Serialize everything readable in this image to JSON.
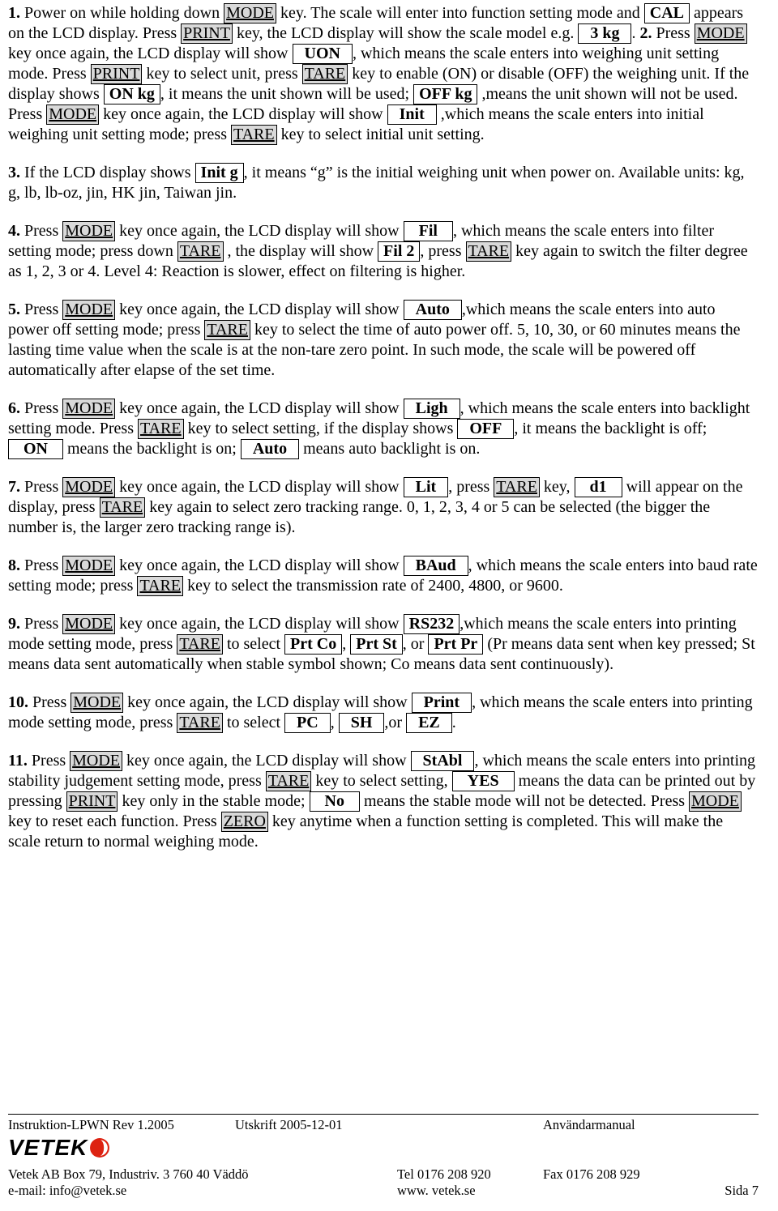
{
  "p1": {
    "n": "1.",
    "t1": " Power on while holding down ",
    "k1": "MODE",
    "t2": " key. The scale will enter into function setting mode and ",
    "l1": "CAL",
    "t3": "appears on the LCD display. Press ",
    "k2": "PRINT",
    "t4": " key, the LCD display will show the scale model e.g. ",
    "l2": "3 kg",
    "t5": ". "
  },
  "p2": {
    "n": "2.",
    "t1": " Press ",
    "k1": "MODE",
    "t2": " key once again, the LCD display will show ",
    "l1": "UON",
    "t3": ", which means the scale enters into weighing unit setting mode. Press ",
    "k2": "PRINT",
    "t4": " key to select unit, press ",
    "k3": "TARE",
    "t5": " key to enable (ON) or disable (OFF) the weighing unit. If the display shows ",
    "l2": "ON kg",
    "t6": ", it means the unit shown will be used; ",
    "l3": "OFF kg",
    "t7": " ,means the unit shown will not be used. Press ",
    "k4": "MODE",
    "t8": " key once again, the LCD display will show ",
    "l4": "Init",
    "t9": " ,which means the scale enters into initial weighing unit setting mode; press ",
    "k5": "TARE",
    "t10": " key to select initial unit setting."
  },
  "p3": {
    "n": "3.",
    "t1": " If the LCD display shows ",
    "l1": "Init  g",
    "t2": ", it means “g” is the initial weighing unit when power on. Available units: kg, g, lb, lb-oz, jin, HK jin, Taiwan jin."
  },
  "p4": {
    "n": "4.",
    "t1": " Press ",
    "k1": "MODE",
    "t2": " key once again, the LCD display will show ",
    "l1": "Fil",
    "t3": ", which means the scale enters into filter setting mode; press down ",
    "k2": "TARE",
    "t4": " , the display will show ",
    "l2": "Fil  2",
    "t5": ", press ",
    "k3": "TARE",
    "t6": " key again to switch the filter degree as 1, 2, 3 or 4. Level 4: Reaction is slower, effect on filtering is higher."
  },
  "p5": {
    "n": "5.",
    "t1": " Press ",
    "k1": "MODE",
    "t2": " key once again, the LCD display will show ",
    "l1": "Auto",
    "t3": ",which means the scale enters into auto power off setting mode; press ",
    "k2": "TARE",
    "t4": " key to select the time of auto power off. 5, 10, 30, or 60 minutes means the lasting time value when the scale is at the non-tare zero point. In such mode, the scale will be powered off automatically after elapse of the set time."
  },
  "p6": {
    "n": "6.",
    "t1": " Press ",
    "k1": "MODE",
    "t2": " key once again, the LCD display will show ",
    "l1": "Ligh",
    "t3": ", which means the scale enters into backlight setting mode. Press ",
    "k2": "TARE",
    "t4": " key to select setting, if the display shows ",
    "l2": "OFF",
    "t5": ", it means the backlight is off; ",
    "l3": "ON",
    "t6": " means the backlight is on; ",
    "l4": "Auto",
    "t7": " means auto backlight is on."
  },
  "p7": {
    "n": "7.",
    "t1": " Press ",
    "k1": "MODE",
    "t2": " key once again, the LCD display will show ",
    "l1": "Lit",
    "t3": ", press ",
    "k2": "TARE",
    "t4": " key, ",
    "l2": "d1",
    "t5": "will appear on the display, press ",
    "k3": "TARE",
    "t6": " key again to select zero tracking range. 0, 1, 2, 3, 4 or 5 can be selected (the bigger the number is, the larger zero tracking range is)."
  },
  "p8": {
    "n": "8.",
    "t1": " Press ",
    "k1": "MODE",
    "t2": " key once again, the LCD display will show ",
    "l1": "BAud",
    "t3": ", which means the scale enters into baud rate setting mode; press ",
    "k2": "TARE",
    "t4": " key to select the transmission rate of 2400, 4800, or 9600."
  },
  "p9": {
    "n": "9.",
    "t1": " Press ",
    "k1": "MODE",
    "t2": " key once again, the LCD display will show ",
    "l1": "RS232",
    "t3": ",which means the scale enters into printing mode setting mode, press ",
    "k2": "TARE",
    "t4": " to select ",
    "l2": "Prt Co",
    "t5": ", ",
    "l3": "Prt St",
    "t6": ", or ",
    "l4": "Prt Pr",
    "t7": " (Pr means data sent when key pressed; St means data sent automatically when stable symbol shown; Co means data sent continuously)."
  },
  "p10": {
    "n": "10.",
    "t1": " Press ",
    "k1": "MODE",
    "t2": " key once again, the LCD display will show ",
    "l1": "Print",
    "t3": ", which means the scale enters into printing mode setting mode, press ",
    "k2": "TARE",
    "t4": " to select ",
    "l2": "PC",
    "t5": ", ",
    "l3": "SH",
    "t6": ",or ",
    "l4": "EZ",
    "t7": "."
  },
  "p11": {
    "n": "11.",
    "t1": " Press ",
    "k1": "MODE",
    "t2": " key once again, the LCD display will show ",
    "l1": "StAbl",
    "t3": ", which means the scale enters into printing stability judgement setting mode, press ",
    "k2": "TARE",
    "t4": " key to select setting, ",
    "l2": "YES",
    "t5": " means the data can be printed out by pressing ",
    "k3": "PRINT",
    "t6": " key only in the stable mode; ",
    "l3": "No",
    "t7": " means the stable mode will not be detected. Press ",
    "k4": "MODE",
    "t8": " key to reset each function. Press ",
    "k5": "ZERO",
    "t9": " key anytime when a function setting is completed. This will make the scale return to normal weighing mode."
  },
  "footer": {
    "doc": "Instruktion-LPWN Rev 1.2005",
    "print": "Utskrift 2005-12-01",
    "manual": "Användarmanual",
    "logo": "VETEK",
    "addr": "Vetek AB Box 79, Industriv. 3  760 40 Väddö",
    "tel": "Tel  0176 208 920",
    "fax": "Fax 0176 208 929",
    "mail": "e-mail: info@vetek.se",
    "web": "www. vetek.se",
    "page": "Sida  7"
  }
}
